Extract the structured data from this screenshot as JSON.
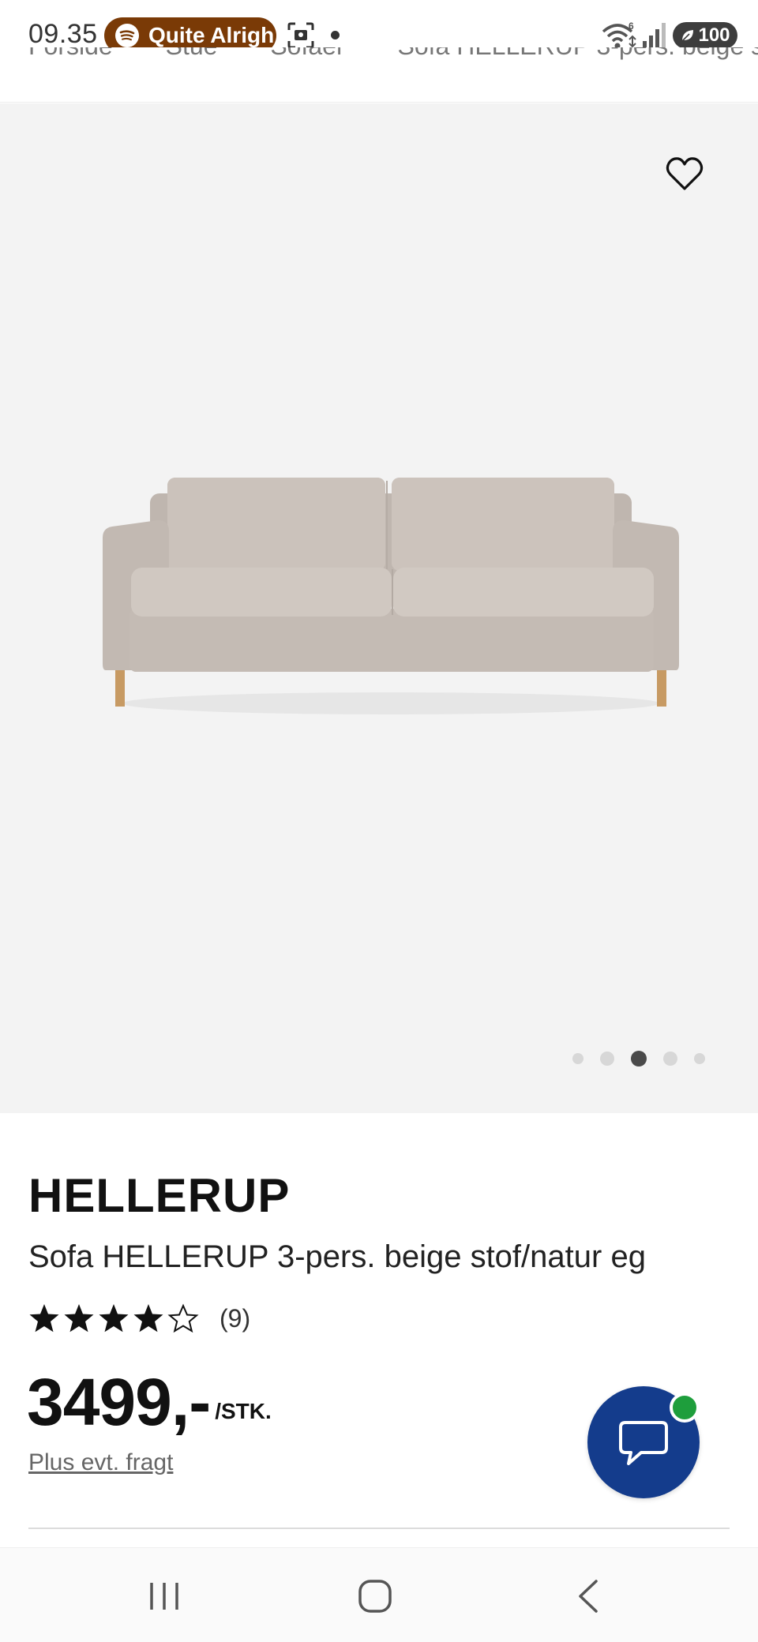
{
  "status_bar": {
    "time": "09.35",
    "media_label": "Quite Alrigh",
    "battery": "100"
  },
  "breadcrumb": [
    "Forside",
    "Stue",
    "Sofaer",
    "Sofa HELLERUP 3-pers. beige stof"
  ],
  "gallery": {
    "total_images": 5,
    "active_index": 2
  },
  "product": {
    "brand": "HELLERUP",
    "subtitle": "Sofa HELLERUP 3-pers. beige stof/natur eg",
    "rating": 4,
    "rating_max": 5,
    "review_count": "(9)",
    "price": "3499,-",
    "price_unit": "/STK.",
    "freight_link": "Plus evt. fragt"
  },
  "colors": {
    "chat_button": "#143c8c",
    "online_indicator": "#1e9e3c",
    "media_pill": "#7a3a06",
    "gallery_background": "#f3f3f3"
  },
  "icons": {
    "wishlist": "heart-outline-icon",
    "chat": "chat-bubble-icon",
    "nav_recent": "recent-apps-icon",
    "nav_home": "home-icon",
    "nav_back": "back-icon"
  }
}
